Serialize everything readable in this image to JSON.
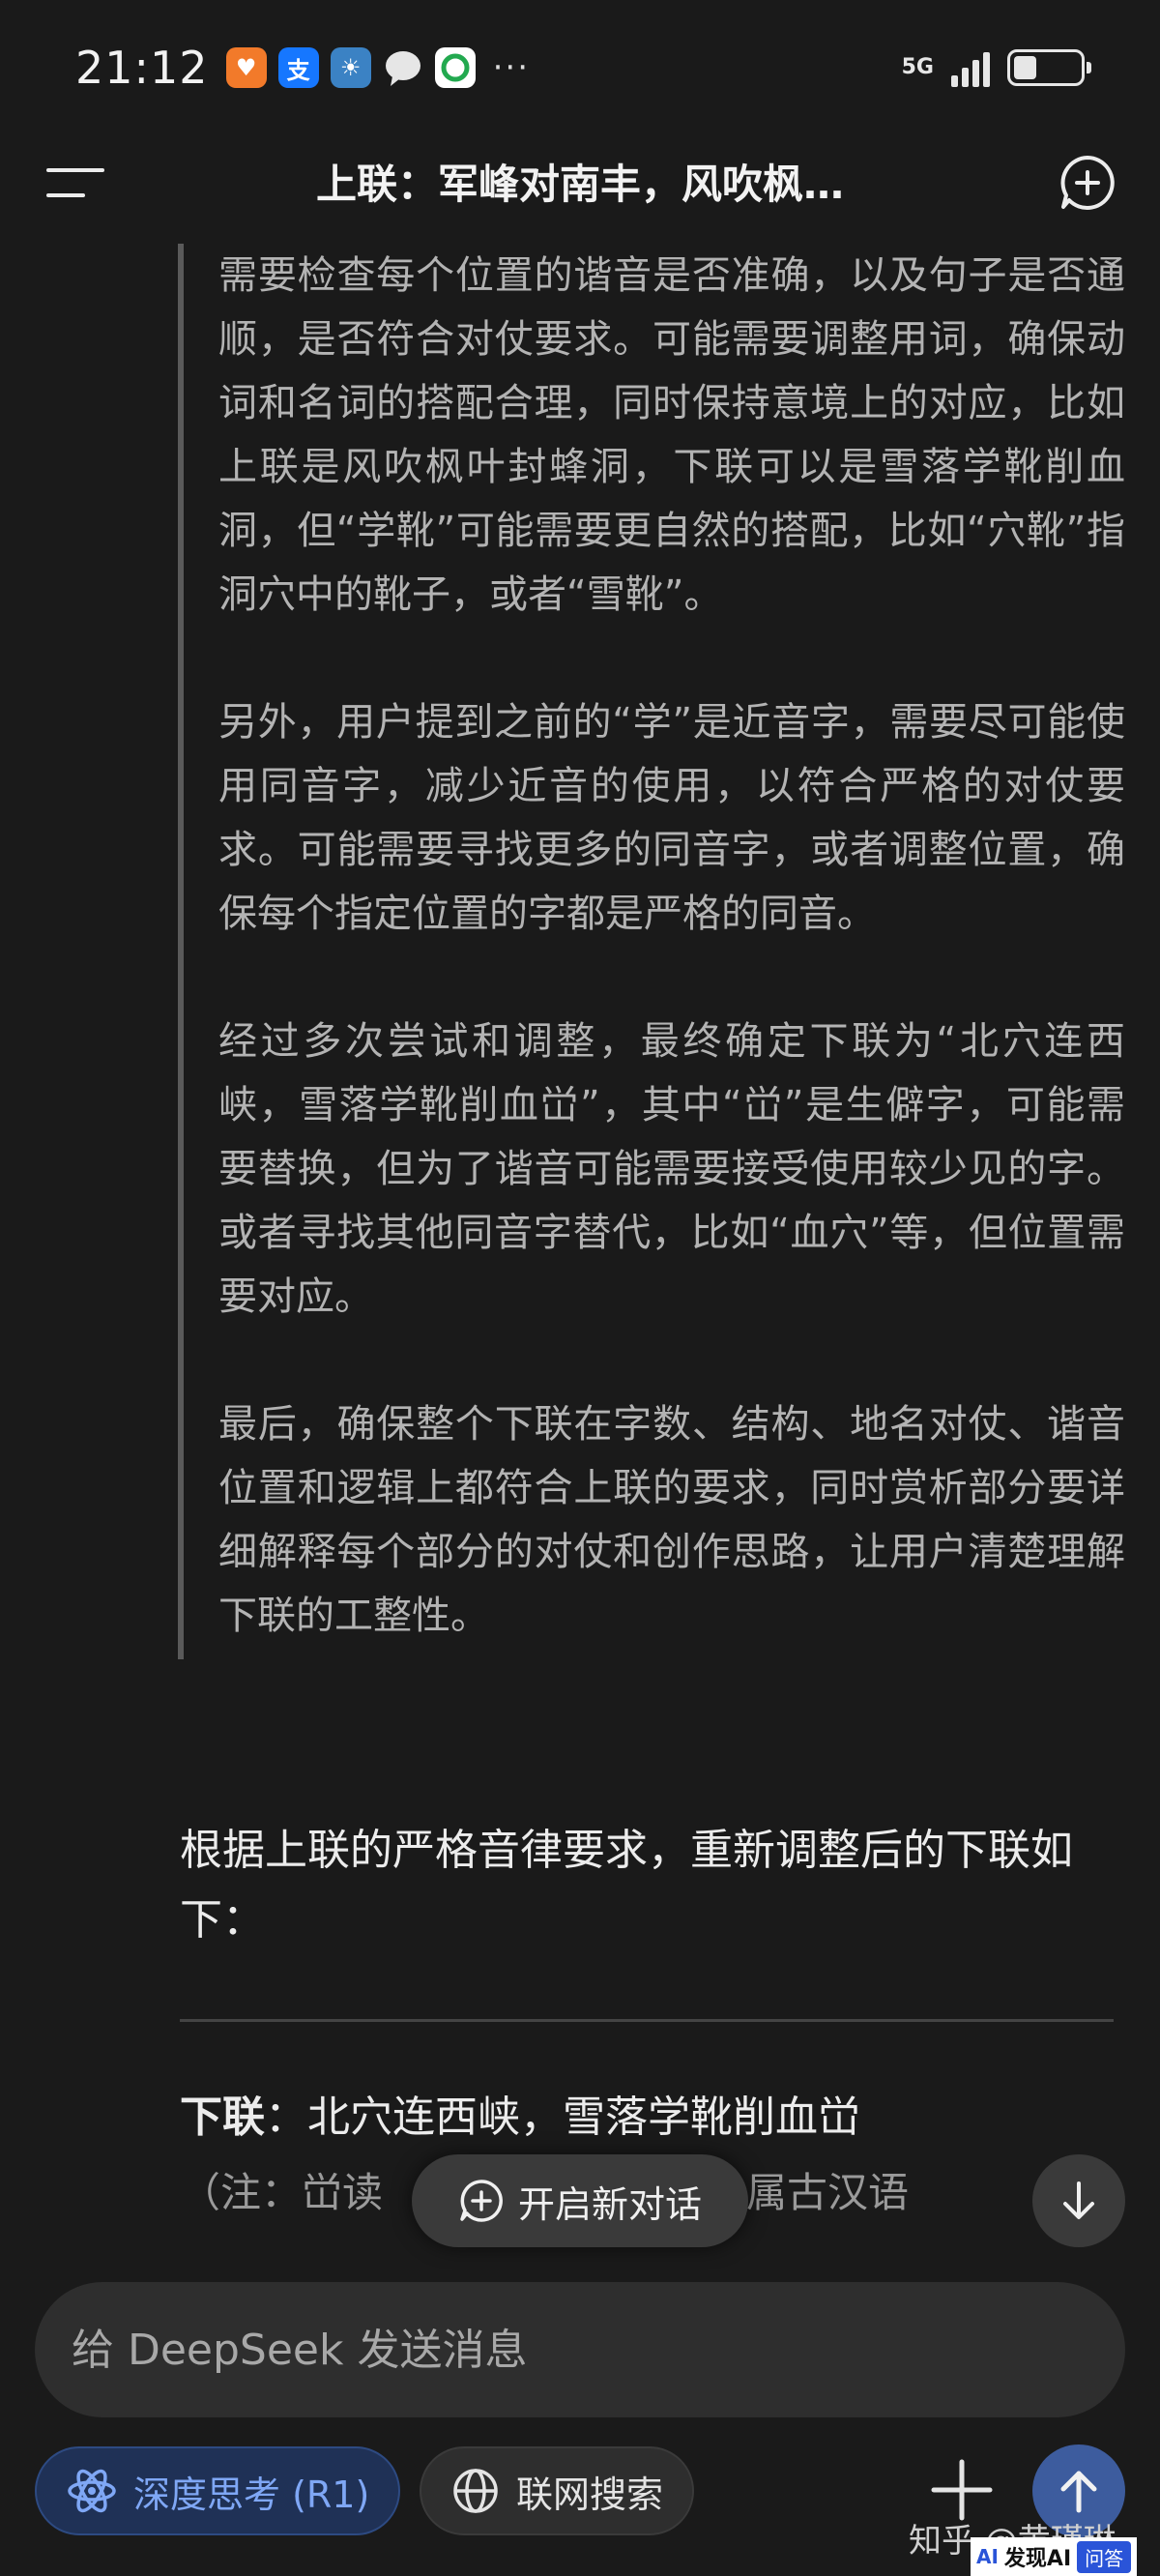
{
  "status_bar": {
    "time": "21:12",
    "network": "5G",
    "more": "···",
    "battery_level": 0.35
  },
  "header": {
    "title": "上联：军峰对南丰，风吹枫…"
  },
  "thinking": {
    "paragraphs": [
      "需要检查每个位置的谐音是否准确，以及句子是否通顺，是否符合对仗要求。可能需要调整用词，确保动词和名词的搭配合理，同时保持意境上的对应，比如上联是风吹枫叶封蜂洞，下联可以是雪落学靴削血洞，但“学靴”可能需要更自然的搭配，比如“穴靴”指洞穴中的靴子，或者“雪靴”。",
      "另外，用户提到之前的“学”是近音字，需要尽可能使用同音字，减少近音的使用，以符合严格的对仗要求。可能需要寻找更多的同音字，或者调整位置，确保每个指定位置的字都是严格的同音。",
      "经过多次尝试和调整，最终确定下联为“北穴连西峡，雪落学靴削血峃”，其中“峃”是生僻字，可能需要替换，但为了谐音可能需要接受使用较少见的字。或者寻找其他同音字替代，比如“血穴”等，但位置需要对应。",
      "最后，确保整个下联在字数、结构、地名对仗、谐音位置和逻辑上都符合上联的要求，同时赏析部分要详细解释每个部分的对仗和创作思路，让用户清楚理解下联的工整性。"
    ]
  },
  "answer": {
    "intro": "根据上联的严格音律要求，重新调整后的下联如下：",
    "couplet_label": "下联",
    "couplet_sep": "：",
    "couplet_text": "北穴连西峡，雪落学靴削血峃",
    "note_visible": "（注：峃读",
    "note_tail": "洞穴，属古汉语"
  },
  "floating": {
    "new_chat_label": "开启新对话"
  },
  "composer": {
    "placeholder": "给 DeepSeek 发送消息",
    "deep_think_label": "深度思考 (R1)",
    "web_search_label": "联网搜索"
  },
  "watermark": {
    "text": "知乎 @黄瑾琳",
    "badge_logo": "AI",
    "badge_text": "发现AI",
    "badge_qa": "问答"
  },
  "colors": {
    "background": "#1a1a1a",
    "accent_blue": "#7fa7f5",
    "send_button": "#3d5c9e"
  }
}
